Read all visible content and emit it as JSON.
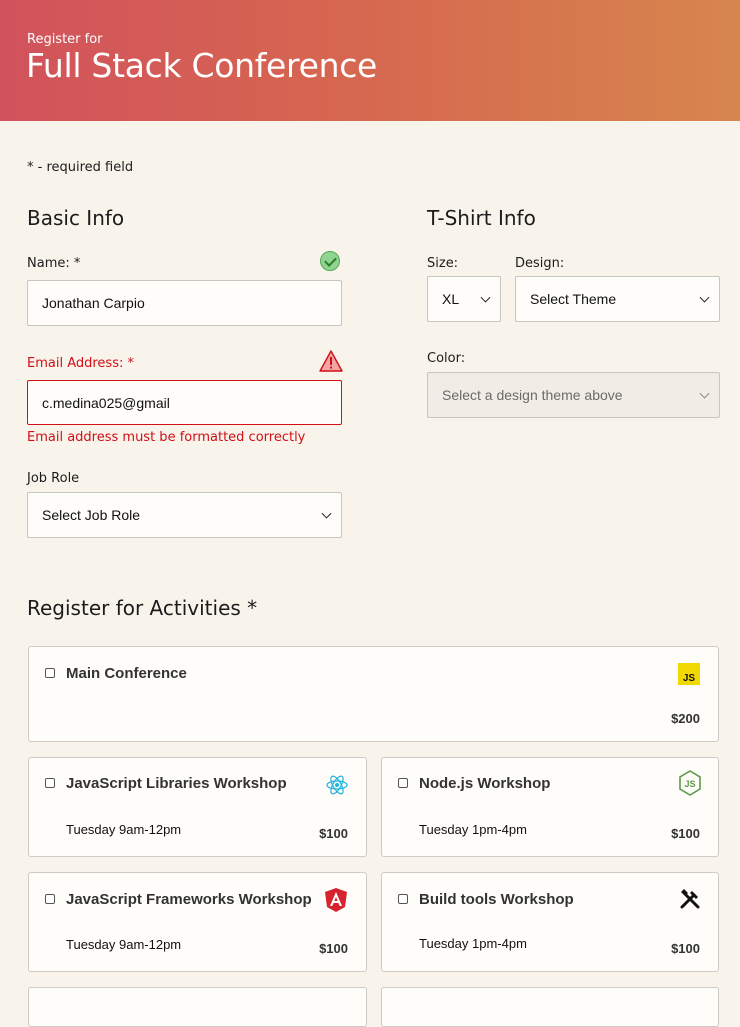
{
  "header": {
    "subtitle": "Register for",
    "title": "Full Stack Conference"
  },
  "required_note": {
    "star": "*",
    "text": " - required field"
  },
  "basic_info": {
    "title": "Basic Info",
    "name_label": "Name:",
    "name_value": "Jonathan Carpio",
    "email_label": "Email Address:",
    "email_value": "c.medina025@gmail",
    "email_error": "Email address must be formatted correctly",
    "job_label": "Job Role",
    "job_value": "Select Job Role",
    "required_star": "*"
  },
  "tshirt": {
    "title": "T-Shirt Info",
    "size_label": "Size:",
    "size_value": "XL",
    "design_label": "Design:",
    "design_value": "Select Theme",
    "color_label": "Color:",
    "color_value": "Select a design theme above"
  },
  "activities": {
    "title": "Register for Activities",
    "required_star": "*",
    "items": [
      {
        "name": "Main Conference",
        "time": "",
        "cost": "$200",
        "icon": "javascript-icon"
      },
      {
        "name": "JavaScript Libraries Workshop",
        "time": "Tuesday 9am-12pm",
        "cost": "$100",
        "icon": "react-icon"
      },
      {
        "name": "Node.js Workshop",
        "time": "Tuesday 1pm-4pm",
        "cost": "$100",
        "icon": "nodejs-icon"
      },
      {
        "name": "JavaScript Frameworks Workshop",
        "time": "Tuesday 9am-12pm",
        "cost": "$100",
        "icon": "angular-icon"
      },
      {
        "name": "Build tools Workshop",
        "time": "Tuesday 1pm-4pm",
        "cost": "$100",
        "icon": "tools-icon"
      }
    ]
  },
  "colors": {
    "header_start": "#d2525c",
    "header_end": "#d7864e",
    "error": "#d20f14",
    "background": "#f8f4ec"
  }
}
